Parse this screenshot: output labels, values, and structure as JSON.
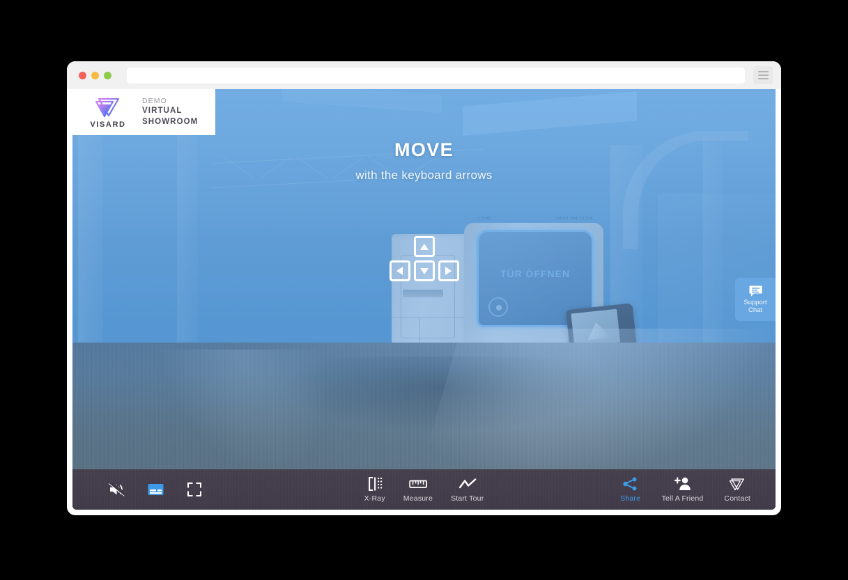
{
  "browser": {
    "url_value": "",
    "url_placeholder": "",
    "menu_icon": "hamburger-menu-icon",
    "traffic_lights": [
      "close-red",
      "minimize-yellow",
      "maximize-green"
    ]
  },
  "banner": {
    "brand_name": "VISARD",
    "logo_icon": "visard-triangle-logo",
    "line_demo": "DEMO",
    "line_1": "VIRTUAL",
    "line_2": "SHOWROOM"
  },
  "hint": {
    "title": "MOVE",
    "subtitle": "with the keyboard arrows"
  },
  "arrow_keys": [
    {
      "name": "arrow-key-up",
      "direction": "up"
    },
    {
      "name": "arrow-key-left",
      "direction": "left"
    },
    {
      "name": "arrow-key-down",
      "direction": "down"
    },
    {
      "name": "arrow-key-right",
      "direction": "right"
    }
  ],
  "support_chat": {
    "icon": "chat-bubble-icon",
    "line_1": "Support",
    "line_2": "Chat"
  },
  "scene": {
    "machine_top_left_text": "L DIAG",
    "machine_top_right_text": "LASER LINE ULTRA",
    "machine_window_text": "TÜR ÖFFNEN"
  },
  "toolbar": {
    "left": [
      {
        "name": "mute-button",
        "icon": "speaker-muted-icon",
        "label": ""
      },
      {
        "name": "subtitles-button",
        "icon": "subtitles-icon",
        "label": ""
      },
      {
        "name": "fullscreen-button",
        "icon": "fullscreen-icon",
        "label": ""
      }
    ],
    "center": [
      {
        "name": "xray-button",
        "icon": "xray-icon",
        "label": "X-Ray"
      },
      {
        "name": "measure-button",
        "icon": "ruler-icon",
        "label": "Measure"
      },
      {
        "name": "start-tour-button",
        "icon": "tour-path-icon",
        "label": "Start Tour"
      }
    ],
    "right": [
      {
        "name": "share-button",
        "icon": "share-nodes-icon",
        "label": "Share"
      },
      {
        "name": "tell-a-friend-button",
        "icon": "person-add-icon",
        "label": "Tell A Friend"
      },
      {
        "name": "contact-button",
        "icon": "visard-triangle-logo",
        "label": "Contact"
      }
    ]
  },
  "colors": {
    "accent_blue": "#3d9ae8",
    "toolbar_bg": "#413b49",
    "scene_blue": "#6ea6d6",
    "chat_bg": "#6aa9e2",
    "logo_gradient_start": "#d07ff0",
    "logo_gradient_end": "#4a6cf7"
  }
}
